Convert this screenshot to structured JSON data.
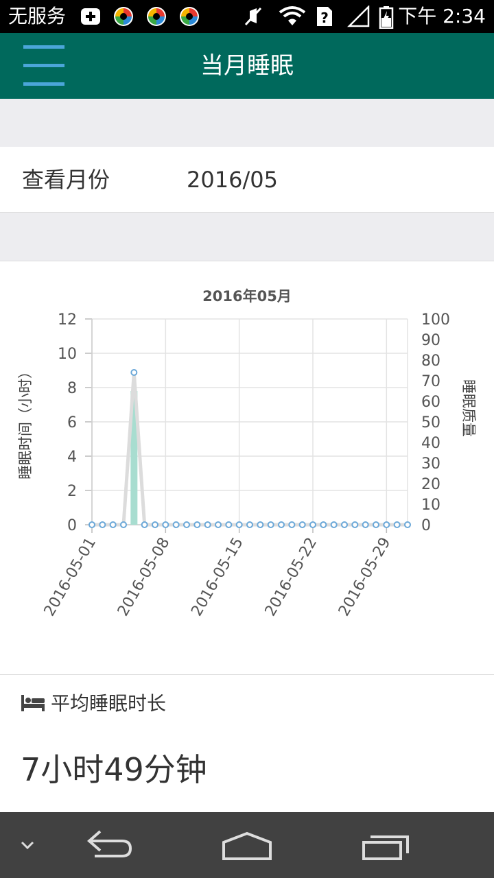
{
  "status_bar": {
    "carrier": "无服务",
    "time": "下午 2:34",
    "icons": [
      "add-box-icon",
      "app-icon",
      "app-icon",
      "app-icon",
      "mute-icon",
      "wifi-icon",
      "sim-unknown-icon",
      "signal-icon",
      "battery-icon"
    ]
  },
  "app_bar": {
    "title": "当月睡眠",
    "menu_icon": "hamburger-menu-icon",
    "background": "#00695c"
  },
  "month_selector": {
    "label": "查看月份",
    "value": "2016/05"
  },
  "chart_data": {
    "type": "bar",
    "title": "2016年05月",
    "x_ticks": [
      "2016-05-01",
      "2016-05-08",
      "2016-05-15",
      "2016-05-22",
      "2016-05-29"
    ],
    "left_axis": {
      "label": "睡眠时间（小时）",
      "ticks": [
        "12",
        "10",
        "8",
        "6",
        "4",
        "2",
        "0"
      ],
      "range": [
        0,
        12
      ]
    },
    "right_axis": {
      "label": "睡眠质量",
      "ticks": [
        "100",
        "90",
        "80",
        "70",
        "60",
        "50",
        "40",
        "30",
        "20",
        "10",
        "0"
      ],
      "range": [
        0,
        100
      ]
    },
    "days": 31,
    "series": [
      {
        "name": "睡眠时间",
        "kind": "bar",
        "axis": "left",
        "color": "#a8ddd0",
        "values": [
          0,
          0,
          0,
          0,
          7.8,
          0,
          0,
          0,
          0,
          0,
          0,
          0,
          0,
          0,
          0,
          0,
          0,
          0,
          0,
          0,
          0,
          0,
          0,
          0,
          0,
          0,
          0,
          0,
          0,
          0,
          0
        ]
      },
      {
        "name": "睡眠质量",
        "kind": "line",
        "axis": "right",
        "color": "#6ba8d8",
        "values": [
          0,
          0,
          0,
          0,
          74,
          0,
          0,
          0,
          0,
          0,
          0,
          0,
          0,
          0,
          0,
          0,
          0,
          0,
          0,
          0,
          0,
          0,
          0,
          0,
          0,
          0,
          0,
          0,
          0,
          0,
          0
        ]
      }
    ],
    "grid": true
  },
  "average": {
    "icon": "bed-icon",
    "label": "平均睡眠时长",
    "value": "7小时49分钟"
  },
  "nav_bar": {
    "buttons": [
      "hide-nav-icon",
      "back-icon",
      "home-icon",
      "recents-icon"
    ]
  }
}
